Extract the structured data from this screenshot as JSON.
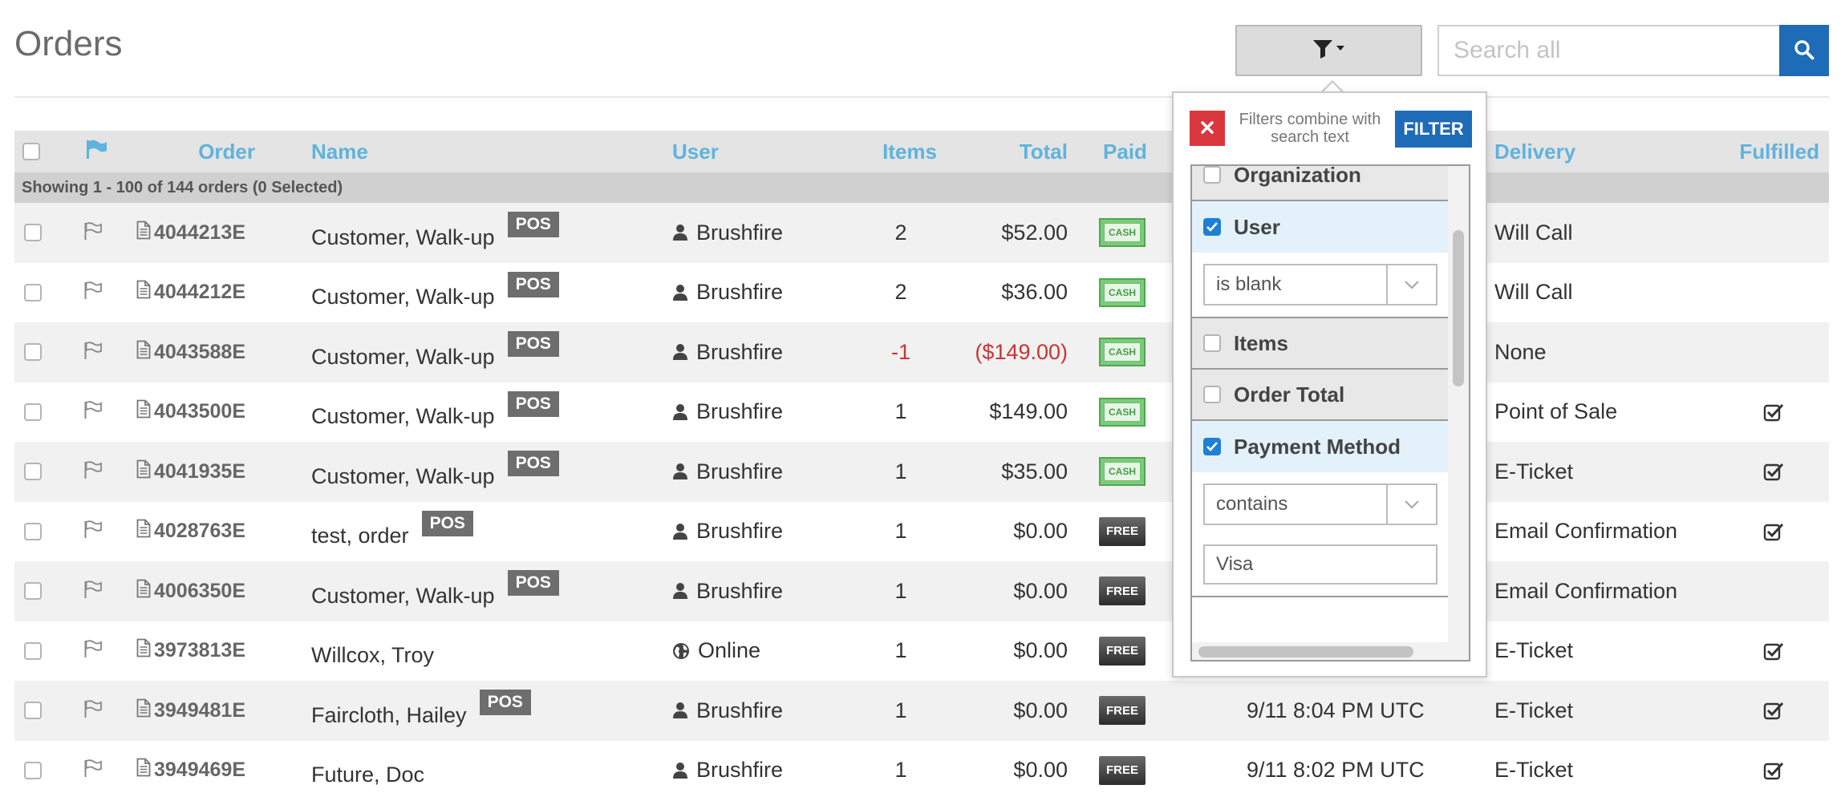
{
  "page_title": "Orders",
  "search": {
    "placeholder": "Search all"
  },
  "table": {
    "headers": {
      "order": "Order",
      "name": "Name",
      "user": "User",
      "items": "Items",
      "total": "Total",
      "paid": "Paid",
      "delivery": "Delivery",
      "fulfilled": "Fulfilled"
    },
    "summary": "Showing 1 - 100 of 144 orders (0 Selected)",
    "rows": [
      {
        "order": "4044213E",
        "name": "Customer, Walk-up",
        "pos": "POS",
        "user_icon": "user-icon",
        "user": "Brushfire",
        "items": "2",
        "total": "$52.00",
        "paid": "CASH",
        "date": "",
        "delivery": "Will Call",
        "fulfilled": false
      },
      {
        "order": "4044212E",
        "name": "Customer, Walk-up",
        "pos": "POS",
        "user_icon": "user-icon",
        "user": "Brushfire",
        "items": "2",
        "total": "$36.00",
        "paid": "CASH",
        "date": "",
        "delivery": "Will Call",
        "fulfilled": false
      },
      {
        "order": "4043588E",
        "name": "Customer, Walk-up",
        "pos": "POS",
        "user_icon": "user-icon",
        "user": "Brushfire",
        "items": "-1",
        "total": "($149.00)",
        "negative": true,
        "paid": "CASH",
        "date": "",
        "delivery": "None",
        "fulfilled": false
      },
      {
        "order": "4043500E",
        "name": "Customer, Walk-up",
        "pos": "POS",
        "user_icon": "user-icon",
        "user": "Brushfire",
        "items": "1",
        "total": "$149.00",
        "paid": "CASH",
        "date": "",
        "delivery": "Point of Sale",
        "fulfilled": true
      },
      {
        "order": "4041935E",
        "name": "Customer, Walk-up",
        "pos": "POS",
        "user_icon": "user-icon",
        "user": "Brushfire",
        "items": "1",
        "total": "$35.00",
        "paid": "CASH",
        "date": "",
        "delivery": "E-Ticket",
        "fulfilled": true
      },
      {
        "order": "4028763E",
        "name": "test, order",
        "pos": "POS",
        "user_icon": "user-icon",
        "user": "Brushfire",
        "items": "1",
        "total": "$0.00",
        "paid": "FREE",
        "date": "",
        "delivery": "Email Confirmation",
        "fulfilled": true
      },
      {
        "order": "4006350E",
        "name": "Customer, Walk-up",
        "pos": "POS",
        "user_icon": "user-icon",
        "user": "Brushfire",
        "items": "1",
        "total": "$0.00",
        "paid": "FREE",
        "date": "",
        "delivery": "Email Confirmation",
        "fulfilled": false
      },
      {
        "order": "3973813E",
        "name": "Willcox, Troy",
        "pos": "",
        "user_icon": "globe-icon",
        "user": "Online",
        "items": "1",
        "total": "$0.00",
        "paid": "FREE",
        "date": "",
        "delivery": "E-Ticket",
        "fulfilled": true
      },
      {
        "order": "3949481E",
        "name": "Faircloth, Hailey",
        "pos": "POS",
        "user_icon": "user-icon",
        "user": "Brushfire",
        "items": "1",
        "total": "$0.00",
        "paid": "FREE",
        "date": "9/11 8:04 PM UTC",
        "delivery": "E-Ticket",
        "fulfilled": true
      },
      {
        "order": "3949469E",
        "name": "Future, Doc",
        "pos": "",
        "user_icon": "user-icon",
        "user": "Brushfire",
        "items": "1",
        "total": "$0.00",
        "paid": "FREE",
        "date": "9/11 8:02 PM UTC",
        "delivery": "E-Ticket",
        "fulfilled": true
      }
    ]
  },
  "filter_popover": {
    "hint": "Filters combine with search text",
    "filter_button": "FILTER",
    "clear_icon": "close-icon",
    "items": [
      {
        "label": "Organization",
        "checked": false
      },
      {
        "label": "User",
        "checked": true,
        "operator": "is blank"
      },
      {
        "label": "Items",
        "checked": false
      },
      {
        "label": "Order Total",
        "checked": false
      },
      {
        "label": "Payment Method",
        "checked": true,
        "operator": "contains",
        "value": "Visa"
      }
    ]
  },
  "colors": {
    "accent_blue": "#1e6bb8",
    "header_text": "#5fb3dd",
    "danger_red": "#d9363e",
    "negative": "#cc3333"
  }
}
